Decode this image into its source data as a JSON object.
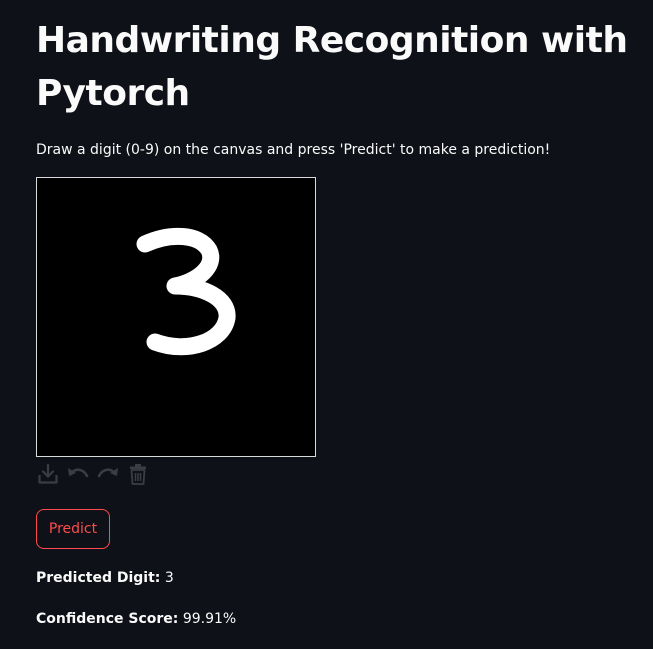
{
  "header": {
    "title": "Handwriting Recognition with Pytorch",
    "subtitle": "Draw a digit (0-9) on the canvas and press 'Predict' to make a prediction!"
  },
  "canvas": {
    "background": "#000000",
    "stroke_color": "#ffffff",
    "drawn_content": "3",
    "toolbar": [
      {
        "icon": "download-icon"
      },
      {
        "icon": "undo-icon"
      },
      {
        "icon": "redo-icon"
      },
      {
        "icon": "trash-icon"
      }
    ]
  },
  "actions": {
    "predict_label": "Predict",
    "accent_color": "#ff4b4b"
  },
  "results": {
    "digit_label": "Predicted Digit:",
    "digit_value": "3",
    "confidence_label": "Confidence Score:",
    "confidence_value": "99.91%"
  },
  "theme": {
    "background": "#0e1117",
    "text": "#fafafa",
    "icon": "#3a3d45"
  }
}
